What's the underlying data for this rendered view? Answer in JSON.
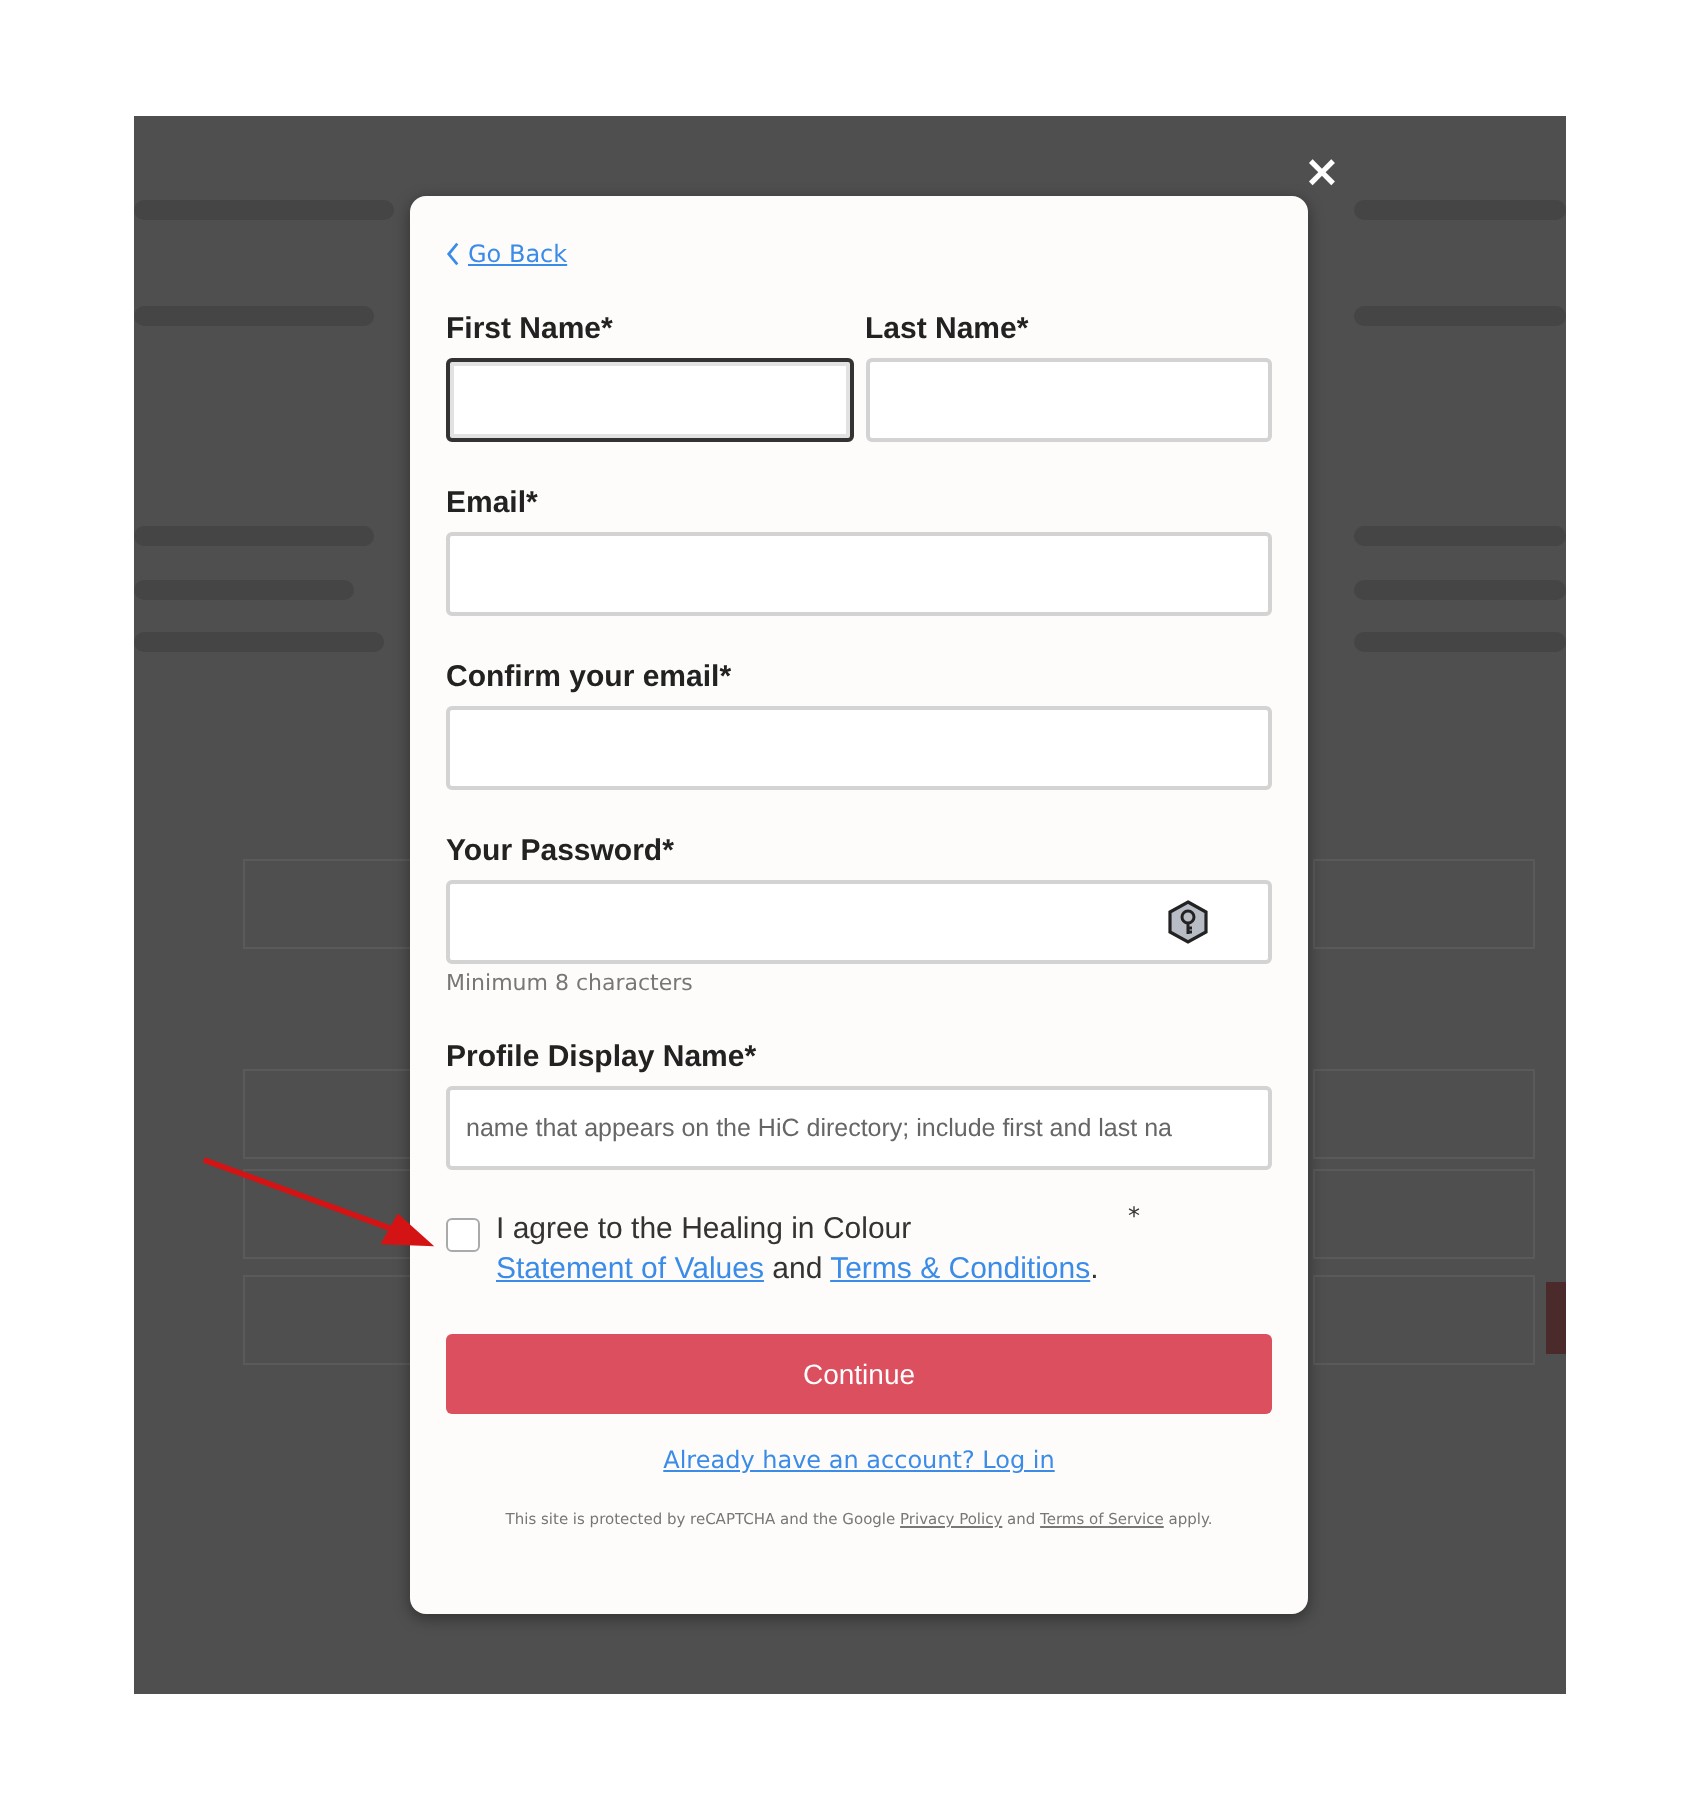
{
  "modal": {
    "close": "×",
    "back_link": "Go Back",
    "name_fields": [
      {
        "label": "First Name*",
        "focused": true
      },
      {
        "label": "Last Name*",
        "focused": false
      }
    ],
    "fields": [
      {
        "label": "Email*",
        "focused": false,
        "kind": "text"
      },
      {
        "label": "Confirm your email*",
        "focused": false,
        "kind": "text"
      },
      {
        "label": "Your Password*",
        "focused": false,
        "kind": "password",
        "hint": "Minimum 8 characters"
      },
      {
        "label": "Profile Display Name*",
        "focused": false,
        "kind": "text",
        "placeholder": "name that appears on the HiC directory; include first and last na"
      }
    ],
    "agreement": {
      "checked": false,
      "text": "I agree to the Healing in Colour",
      "required": "*",
      "link_1": "Statement of Values",
      "joiner": "and",
      "link_2": "Terms & Conditions",
      "end": "."
    },
    "submit": "Continue",
    "login_link": "Already have an account? Log in",
    "recaptcha": {
      "text_1": "This site is protected by reCAPTCHA and the Google",
      "link_1": "Privacy Policy",
      "text_2": "and",
      "link_2": "Terms of Service",
      "text_3": "apply."
    }
  }
}
